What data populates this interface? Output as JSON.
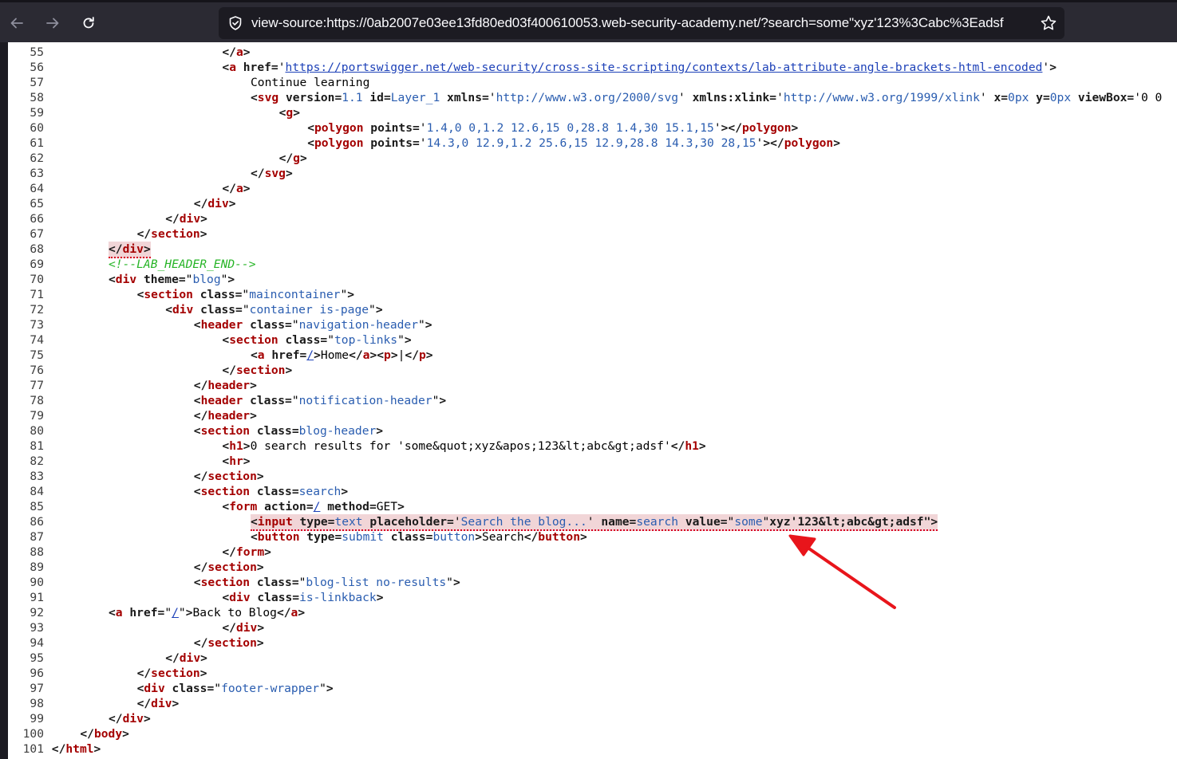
{
  "browser": {
    "url": "view-source:https://0ab2007e03ee13fd80ed03f400610053.web-security-academy.net/?search=some\"xyz'123%3Cabc%3Eadsf",
    "back_icon": "arrow-left-icon",
    "forward_icon": "arrow-right-icon",
    "reload_icon": "reload-icon",
    "security_icon": "shield-icon",
    "bookmark_icon": "star-icon"
  },
  "source_lines": [
    {
      "n": "55",
      "indent": 16,
      "seg": [
        [
          "b",
          "</"
        ],
        [
          "t",
          "a"
        ],
        [
          "b",
          ">"
        ]
      ]
    },
    {
      "n": "56",
      "indent": 16,
      "seg": [
        [
          "b",
          "<"
        ],
        [
          "t",
          "a"
        ],
        [
          "b",
          " href="
        ],
        [
          "n",
          "'"
        ],
        [
          "u",
          "https://portswigger.net/web-security/cross-site-scripting/contexts/lab-attribute-angle-brackets-html-encoded"
        ],
        [
          "n",
          "'"
        ],
        [
          "b",
          ">"
        ]
      ]
    },
    {
      "n": "57",
      "indent": 20,
      "seg": [
        [
          "n",
          "Continue learning"
        ]
      ]
    },
    {
      "n": "58",
      "indent": 20,
      "seg": [
        [
          "b",
          "<"
        ],
        [
          "t",
          "svg"
        ],
        [
          "b",
          " version="
        ],
        [
          "v",
          "1.1"
        ],
        [
          "b",
          " id="
        ],
        [
          "v",
          "Layer_1"
        ],
        [
          "b",
          " xmlns="
        ],
        [
          "n",
          "'"
        ],
        [
          "v",
          "http://www.w3.org/2000/svg"
        ],
        [
          "n",
          "'"
        ],
        [
          "b",
          " xmlns:xlink="
        ],
        [
          "n",
          "'"
        ],
        [
          "v",
          "http://www.w3.org/1999/xlink"
        ],
        [
          "n",
          "'"
        ],
        [
          "b",
          " x="
        ],
        [
          "v",
          "0px"
        ],
        [
          "b",
          " y="
        ],
        [
          "v",
          "0px"
        ],
        [
          "b",
          " viewBox="
        ],
        [
          "n",
          "'0 0"
        ]
      ]
    },
    {
      "n": "59",
      "indent": 24,
      "seg": [
        [
          "b",
          "<"
        ],
        [
          "t",
          "g"
        ],
        [
          "b",
          ">"
        ]
      ]
    },
    {
      "n": "60",
      "indent": 28,
      "seg": [
        [
          "b",
          "<"
        ],
        [
          "t",
          "polygon"
        ],
        [
          "b",
          " points="
        ],
        [
          "n",
          "'"
        ],
        [
          "v",
          "1.4,0 0,1.2 12.6,15 0,28.8 1.4,30 15.1,15"
        ],
        [
          "n",
          "'"
        ],
        [
          "b",
          ">"
        ],
        [
          "b",
          "</"
        ],
        [
          "t",
          "polygon"
        ],
        [
          "b",
          ">"
        ]
      ]
    },
    {
      "n": "61",
      "indent": 28,
      "seg": [
        [
          "b",
          "<"
        ],
        [
          "t",
          "polygon"
        ],
        [
          "b",
          " points="
        ],
        [
          "n",
          "'"
        ],
        [
          "v",
          "14.3,0 12.9,1.2 25.6,15 12.9,28.8 14.3,30 28,15"
        ],
        [
          "n",
          "'"
        ],
        [
          "b",
          ">"
        ],
        [
          "b",
          "</"
        ],
        [
          "t",
          "polygon"
        ],
        [
          "b",
          ">"
        ]
      ]
    },
    {
      "n": "62",
      "indent": 24,
      "seg": [
        [
          "b",
          "</"
        ],
        [
          "t",
          "g"
        ],
        [
          "b",
          ">"
        ]
      ]
    },
    {
      "n": "63",
      "indent": 20,
      "seg": [
        [
          "b",
          "</"
        ],
        [
          "t",
          "svg"
        ],
        [
          "b",
          ">"
        ]
      ]
    },
    {
      "n": "64",
      "indent": 16,
      "seg": [
        [
          "b",
          "</"
        ],
        [
          "t",
          "a"
        ],
        [
          "b",
          ">"
        ]
      ]
    },
    {
      "n": "65",
      "indent": 12,
      "seg": [
        [
          "b",
          "</"
        ],
        [
          "t",
          "div"
        ],
        [
          "b",
          ">"
        ]
      ]
    },
    {
      "n": "66",
      "indent": 8,
      "seg": [
        [
          "b",
          "</"
        ],
        [
          "t",
          "div"
        ],
        [
          "b",
          ">"
        ]
      ]
    },
    {
      "n": "67",
      "indent": 4,
      "seg": [
        [
          "b",
          "</"
        ],
        [
          "t",
          "section"
        ],
        [
          "b",
          ">"
        ]
      ]
    },
    {
      "n": "68",
      "indent": 0,
      "err": true,
      "seg": [
        [
          "b",
          "</"
        ],
        [
          "t",
          "div"
        ],
        [
          "b",
          ">"
        ]
      ]
    },
    {
      "n": "69",
      "indent": 0,
      "seg": [
        [
          "c",
          "<!--LAB_HEADER_END-->"
        ]
      ]
    },
    {
      "n": "70",
      "indent": 0,
      "seg": [
        [
          "b",
          "<"
        ],
        [
          "t",
          "div"
        ],
        [
          "b",
          " theme="
        ],
        [
          "n",
          "\""
        ],
        [
          "v",
          "blog"
        ],
        [
          "n",
          "\""
        ],
        [
          "b",
          ">"
        ]
      ]
    },
    {
      "n": "71",
      "indent": 4,
      "seg": [
        [
          "b",
          "<"
        ],
        [
          "t",
          "section"
        ],
        [
          "b",
          " class="
        ],
        [
          "n",
          "\""
        ],
        [
          "v",
          "maincontainer"
        ],
        [
          "n",
          "\""
        ],
        [
          "b",
          ">"
        ]
      ]
    },
    {
      "n": "72",
      "indent": 8,
      "seg": [
        [
          "b",
          "<"
        ],
        [
          "t",
          "div"
        ],
        [
          "b",
          " class="
        ],
        [
          "n",
          "\""
        ],
        [
          "v",
          "container is-page"
        ],
        [
          "n",
          "\""
        ],
        [
          "b",
          ">"
        ]
      ]
    },
    {
      "n": "73",
      "indent": 12,
      "seg": [
        [
          "b",
          "<"
        ],
        [
          "t",
          "header"
        ],
        [
          "b",
          " class="
        ],
        [
          "n",
          "\""
        ],
        [
          "v",
          "navigation-header"
        ],
        [
          "n",
          "\""
        ],
        [
          "b",
          ">"
        ]
      ]
    },
    {
      "n": "74",
      "indent": 16,
      "seg": [
        [
          "b",
          "<"
        ],
        [
          "t",
          "section"
        ],
        [
          "b",
          " class="
        ],
        [
          "n",
          "\""
        ],
        [
          "v",
          "top-links"
        ],
        [
          "n",
          "\""
        ],
        [
          "b",
          ">"
        ]
      ]
    },
    {
      "n": "75",
      "indent": 20,
      "seg": [
        [
          "b",
          "<"
        ],
        [
          "t",
          "a"
        ],
        [
          "b",
          " href="
        ],
        [
          "u",
          "/"
        ],
        [
          "b",
          ">"
        ],
        [
          "n",
          "Home"
        ],
        [
          "b",
          "</"
        ],
        [
          "t",
          "a"
        ],
        [
          "b",
          ">"
        ],
        [
          "b",
          "<"
        ],
        [
          "t",
          "p"
        ],
        [
          "b",
          ">"
        ],
        [
          "n",
          "|"
        ],
        [
          "b",
          "</"
        ],
        [
          "t",
          "p"
        ],
        [
          "b",
          ">"
        ]
      ]
    },
    {
      "n": "76",
      "indent": 16,
      "seg": [
        [
          "b",
          "</"
        ],
        [
          "t",
          "section"
        ],
        [
          "b",
          ">"
        ]
      ]
    },
    {
      "n": "77",
      "indent": 12,
      "seg": [
        [
          "b",
          "</"
        ],
        [
          "t",
          "header"
        ],
        [
          "b",
          ">"
        ]
      ]
    },
    {
      "n": "78",
      "indent": 12,
      "seg": [
        [
          "b",
          "<"
        ],
        [
          "t",
          "header"
        ],
        [
          "b",
          " class="
        ],
        [
          "n",
          "\""
        ],
        [
          "v",
          "notification-header"
        ],
        [
          "n",
          "\""
        ],
        [
          "b",
          ">"
        ]
      ]
    },
    {
      "n": "79",
      "indent": 12,
      "seg": [
        [
          "b",
          "</"
        ],
        [
          "t",
          "header"
        ],
        [
          "b",
          ">"
        ]
      ]
    },
    {
      "n": "80",
      "indent": 12,
      "seg": [
        [
          "b",
          "<"
        ],
        [
          "t",
          "section"
        ],
        [
          "b",
          " class="
        ],
        [
          "v",
          "blog-header"
        ],
        [
          "b",
          ">"
        ]
      ]
    },
    {
      "n": "81",
      "indent": 16,
      "seg": [
        [
          "b",
          "<"
        ],
        [
          "t",
          "h1"
        ],
        [
          "b",
          ">"
        ],
        [
          "n",
          "0 search results for 'some&quot;xyz&apos;123&lt;abc&gt;adsf'"
        ],
        [
          "b",
          "</"
        ],
        [
          "t",
          "h1"
        ],
        [
          "b",
          ">"
        ]
      ]
    },
    {
      "n": "82",
      "indent": 16,
      "seg": [
        [
          "b",
          "<"
        ],
        [
          "t",
          "hr"
        ],
        [
          "b",
          ">"
        ]
      ]
    },
    {
      "n": "83",
      "indent": 12,
      "seg": [
        [
          "b",
          "</"
        ],
        [
          "t",
          "section"
        ],
        [
          "b",
          ">"
        ]
      ]
    },
    {
      "n": "84",
      "indent": 12,
      "seg": [
        [
          "b",
          "<"
        ],
        [
          "t",
          "section"
        ],
        [
          "b",
          " class="
        ],
        [
          "v",
          "search"
        ],
        [
          "b",
          ">"
        ]
      ]
    },
    {
      "n": "85",
      "indent": 16,
      "seg": [
        [
          "b",
          "<"
        ],
        [
          "t",
          "form"
        ],
        [
          "b",
          " action="
        ],
        [
          "u",
          "/"
        ],
        [
          "b",
          " method="
        ],
        [
          "n",
          "GET"
        ],
        [
          "b",
          ">"
        ]
      ]
    },
    {
      "n": "86",
      "indent": 20,
      "err": true,
      "seg": [
        [
          "b",
          "<"
        ],
        [
          "t",
          "input"
        ],
        [
          "b",
          " type="
        ],
        [
          "v",
          "text"
        ],
        [
          "b",
          " placeholder="
        ],
        [
          "n",
          "'"
        ],
        [
          "v",
          "Search the blog..."
        ],
        [
          "n",
          "'"
        ],
        [
          "b",
          " name="
        ],
        [
          "v",
          "search"
        ],
        [
          "b",
          " value="
        ],
        [
          "n",
          "\""
        ],
        [
          "v",
          "some"
        ],
        [
          "n",
          "\""
        ],
        [
          "b",
          "xyz'123&lt;abc&gt;adsf\">"
        ]
      ]
    },
    {
      "n": "87",
      "indent": 20,
      "seg": [
        [
          "b",
          "<"
        ],
        [
          "t",
          "button"
        ],
        [
          "b",
          " type="
        ],
        [
          "v",
          "submit"
        ],
        [
          "b",
          " class="
        ],
        [
          "v",
          "button"
        ],
        [
          "b",
          ">"
        ],
        [
          "n",
          "Search"
        ],
        [
          "b",
          "</"
        ],
        [
          "t",
          "button"
        ],
        [
          "b",
          ">"
        ]
      ]
    },
    {
      "n": "88",
      "indent": 16,
      "seg": [
        [
          "b",
          "</"
        ],
        [
          "t",
          "form"
        ],
        [
          "b",
          ">"
        ]
      ]
    },
    {
      "n": "89",
      "indent": 12,
      "seg": [
        [
          "b",
          "</"
        ],
        [
          "t",
          "section"
        ],
        [
          "b",
          ">"
        ]
      ]
    },
    {
      "n": "90",
      "indent": 12,
      "seg": [
        [
          "b",
          "<"
        ],
        [
          "t",
          "section"
        ],
        [
          "b",
          " class="
        ],
        [
          "n",
          "\""
        ],
        [
          "v",
          "blog-list no-results"
        ],
        [
          "n",
          "\""
        ],
        [
          "b",
          ">"
        ]
      ]
    },
    {
      "n": "91",
      "indent": 16,
      "seg": [
        [
          "b",
          "<"
        ],
        [
          "t",
          "div"
        ],
        [
          "b",
          " class="
        ],
        [
          "v",
          "is-linkback"
        ],
        [
          "b",
          ">"
        ]
      ]
    },
    {
      "n": "92",
      "indent": 0,
      "seg": [
        [
          "b",
          "<"
        ],
        [
          "t",
          "a"
        ],
        [
          "b",
          " href="
        ],
        [
          "n",
          "\""
        ],
        [
          "u",
          "/"
        ],
        [
          "n",
          "\""
        ],
        [
          "b",
          ">"
        ],
        [
          "n",
          "Back to Blog"
        ],
        [
          "b",
          "</"
        ],
        [
          "t",
          "a"
        ],
        [
          "b",
          ">"
        ]
      ]
    },
    {
      "n": "93",
      "indent": 16,
      "seg": [
        [
          "b",
          "</"
        ],
        [
          "t",
          "div"
        ],
        [
          "b",
          ">"
        ]
      ]
    },
    {
      "n": "94",
      "indent": 12,
      "seg": [
        [
          "b",
          "</"
        ],
        [
          "t",
          "section"
        ],
        [
          "b",
          ">"
        ]
      ]
    },
    {
      "n": "95",
      "indent": 8,
      "seg": [
        [
          "b",
          "</"
        ],
        [
          "t",
          "div"
        ],
        [
          "b",
          ">"
        ]
      ]
    },
    {
      "n": "96",
      "indent": 4,
      "seg": [
        [
          "b",
          "</"
        ],
        [
          "t",
          "section"
        ],
        [
          "b",
          ">"
        ]
      ]
    },
    {
      "n": "97",
      "indent": 4,
      "seg": [
        [
          "b",
          "<"
        ],
        [
          "t",
          "div"
        ],
        [
          "b",
          " class="
        ],
        [
          "n",
          "\""
        ],
        [
          "v",
          "footer-wrapper"
        ],
        [
          "n",
          "\""
        ],
        [
          "b",
          ">"
        ]
      ]
    },
    {
      "n": "98",
      "indent": 4,
      "seg": [
        [
          "b",
          "</"
        ],
        [
          "t",
          "div"
        ],
        [
          "b",
          ">"
        ]
      ]
    },
    {
      "n": "99",
      "indent": 0,
      "seg": [
        [
          "b",
          "</"
        ],
        [
          "t",
          "div"
        ],
        [
          "b",
          ">"
        ]
      ]
    },
    {
      "n": "100",
      "indent": -4,
      "seg": [
        [
          "b",
          "</"
        ],
        [
          "t",
          "body"
        ],
        [
          "b",
          ">"
        ]
      ]
    },
    {
      "n": "101",
      "indent": -8,
      "seg": [
        [
          "b",
          "</"
        ],
        [
          "t",
          "html"
        ],
        [
          "b",
          ">"
        ]
      ]
    }
  ],
  "annotation": {
    "type": "arrow",
    "color": "#e8151b",
    "points_to": "line-86-value"
  }
}
